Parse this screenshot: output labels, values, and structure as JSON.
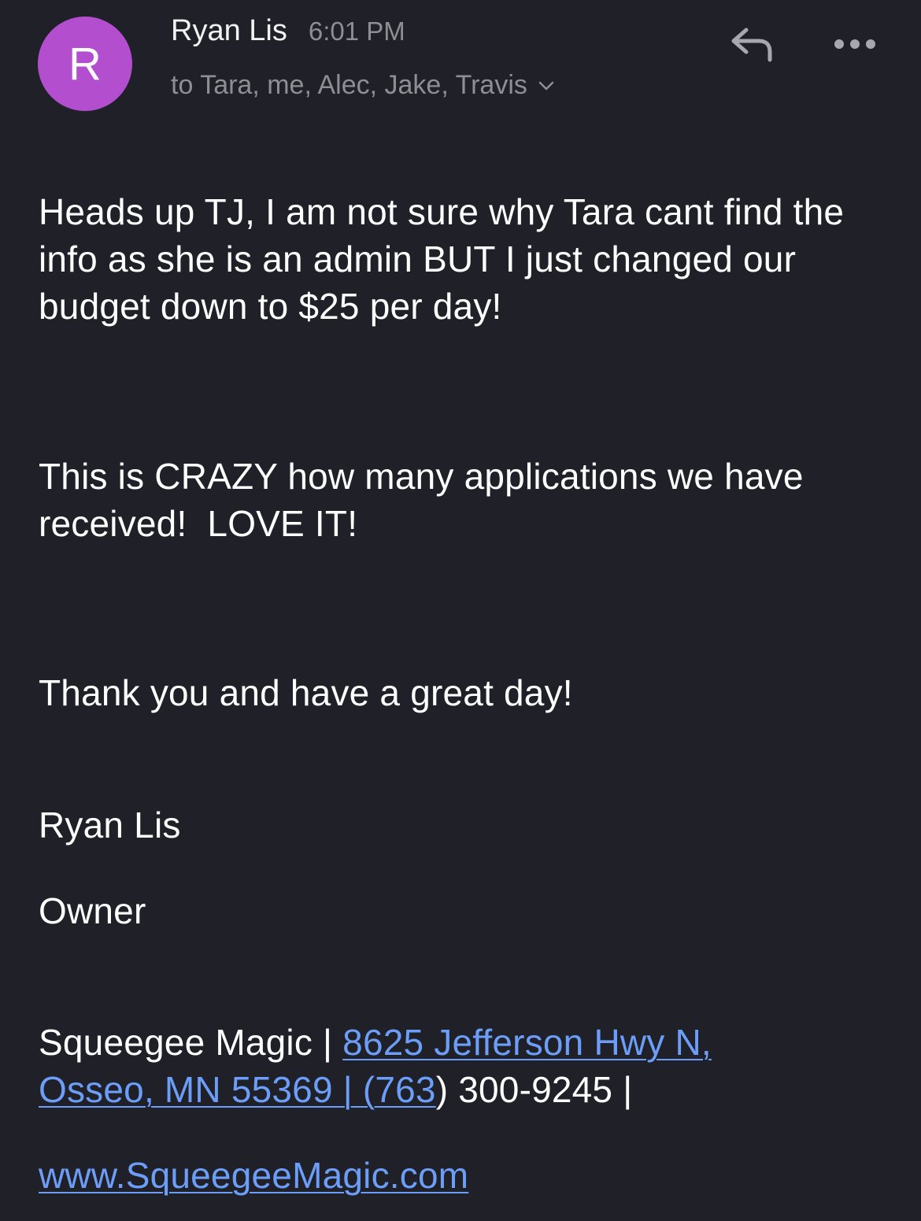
{
  "header": {
    "avatar_letter": "R",
    "avatar_color": "#b34fcf",
    "sender_name": "Ryan Lis",
    "time": "6:01 PM",
    "recipients": "to Tara, me, Alec, Jake, Travis",
    "reply_icon": "reply-arrow-icon",
    "more_icon": "more-dots-icon",
    "expand_icon": "chevron-down-icon"
  },
  "message": {
    "paragraph_1": "Heads up TJ, I am not sure why Tara cant find the info as she is an admin BUT I just changed our budget down to $25 per day!",
    "paragraph_2": "This is CRAZY how many applications we have received!  LOVE IT!",
    "paragraph_3": "Thank you and have a great day!"
  },
  "signature": {
    "name": "Ryan Lis",
    "title": "Owner",
    "company_prefix": "Squeegee Magic | ",
    "address_link": "8625 Jefferson Hwy N, Osseo, MN 55369 | (763",
    "phone_suffix": ") 300-9245 |",
    "website": "www.SqueegeeMagic.com"
  },
  "colors": {
    "background": "#1f2028",
    "link": "#6c9ef8",
    "secondary_text": "#8e8e93"
  }
}
